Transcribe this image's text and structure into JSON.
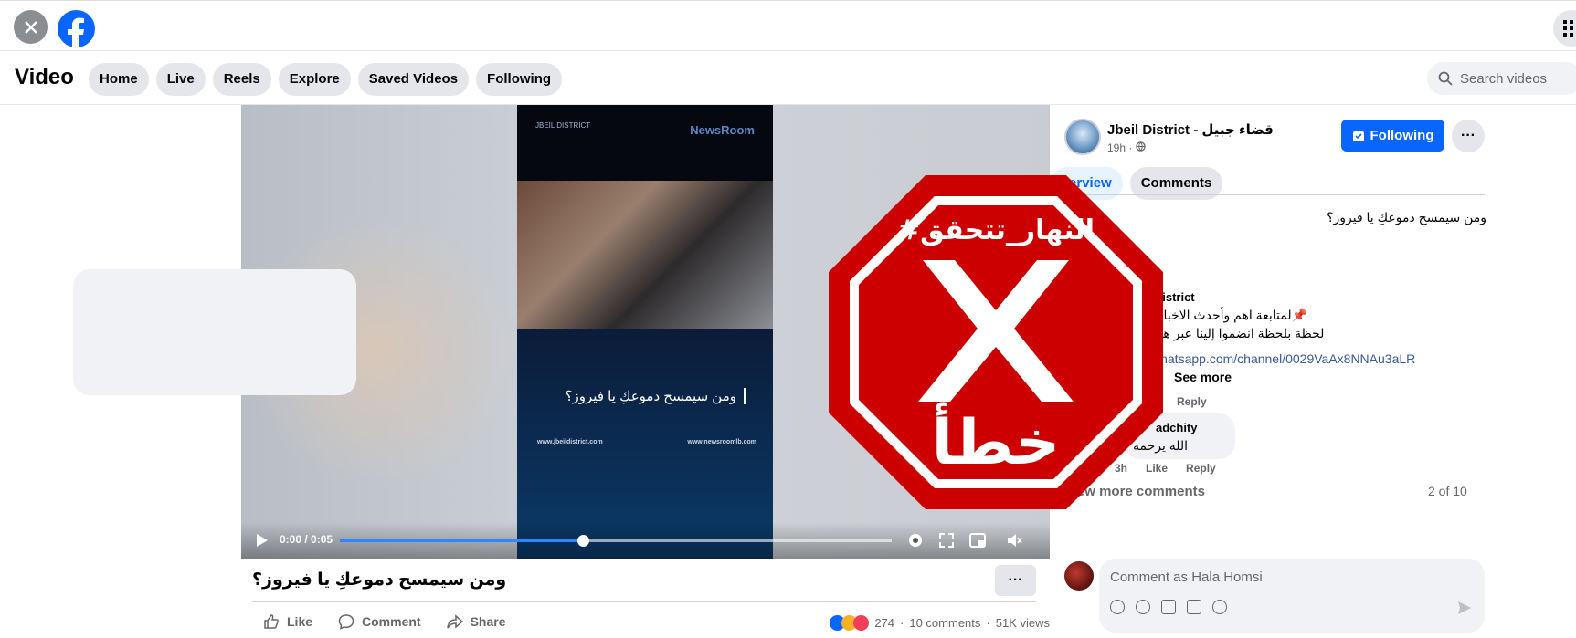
{
  "topbar": {
    "close_icon": "close-icon",
    "logo": "facebook-logo",
    "menu_icon": "grid-menu-icon"
  },
  "nav": {
    "title": "Video",
    "pills": [
      "Home",
      "Live",
      "Reels",
      "Explore",
      "Saved Videos",
      "Following"
    ],
    "search_placeholder": "Search videos"
  },
  "video": {
    "frame_logo_left": "JBEIL DISTRICT",
    "frame_logo_right": "NewsRoom",
    "frame_caption": "ومن سيمسح دموعكِ يا فيروز؟",
    "url_left": "www.jbeildistrict.com",
    "url_right": "www.newsroomlb.com",
    "time": "0:00 / 0:05",
    "progress": 0.44
  },
  "post": {
    "caption": "ومن سيمسح دموعكِ يا فيروز؟",
    "actions": [
      "Like",
      "Comment",
      "Share"
    ],
    "reactions_count": "274",
    "comments_count": "10 comments",
    "views": "51K views"
  },
  "side": {
    "page_name": "Jbeil District - قضاء جبيل",
    "meta": "19h ·",
    "follow_label": "Following",
    "tabs": [
      "Overview",
      "Comments"
    ],
    "caption": "ومن سيمسح دموعكِ يا فيروز؟",
    "comment1": {
      "name": "Jbeil District - قضاء جبيل",
      "line1": "📌لمتابعة اهم وأحدث الاخبار الموثوقة في لبنان و",
      "line2": "لحظة بلحظة انضموا إلينا عبر هذا الرابط:👇",
      "link": "whatsapp.com/channel/0029VaAx8NNAu3aLR",
      "see_more": "See more",
      "reply": "Reply"
    },
    "comment2": {
      "name": "adchity",
      "text": "الله يرحمه",
      "time": "3h",
      "like": "Like",
      "reply": "Reply"
    },
    "view_more": "View more comments",
    "count": "2 of 10",
    "input_placeholder": "Comment as Hala Homsi"
  },
  "stamp": {
    "hashtag": "#النهار_تتحقق",
    "verdict": "خطأ",
    "colors": {
      "red": "#cc0000",
      "white": "#ffffff"
    }
  }
}
